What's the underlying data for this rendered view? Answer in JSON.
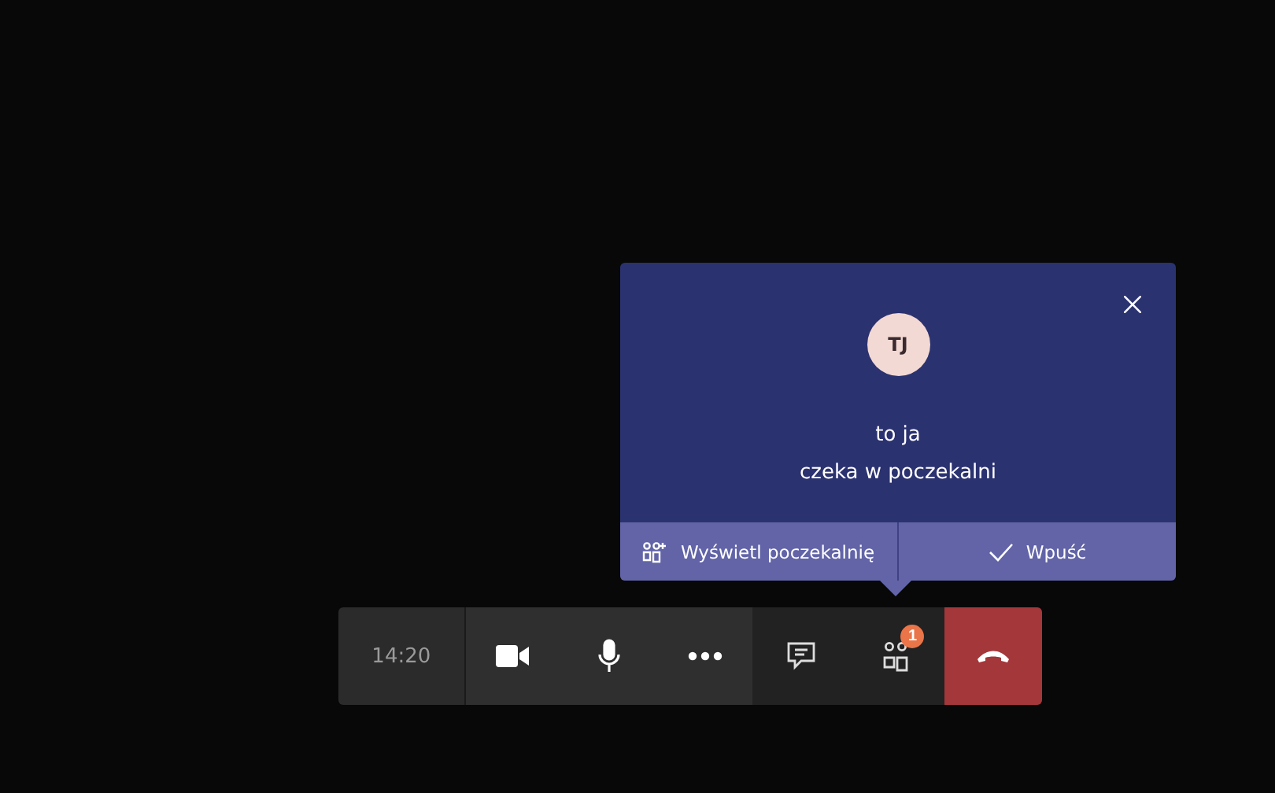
{
  "lobby_popup": {
    "avatar": "TJ",
    "name": "to ja",
    "message": "czeka w poczekalni",
    "actions": [
      {
        "kind": "lobby",
        "label": "Wyświetl poczekalnię"
      },
      {
        "kind": "admit",
        "label": "Wpuść"
      }
    ]
  },
  "call_toolbar": {
    "time": "14:20",
    "buttons": [
      {
        "kind": "video"
      },
      {
        "kind": "mic"
      },
      {
        "kind": "more"
      },
      {
        "kind": "chat"
      },
      {
        "kind": "people",
        "badge": "1"
      },
      {
        "kind": "hangup"
      }
    ]
  }
}
